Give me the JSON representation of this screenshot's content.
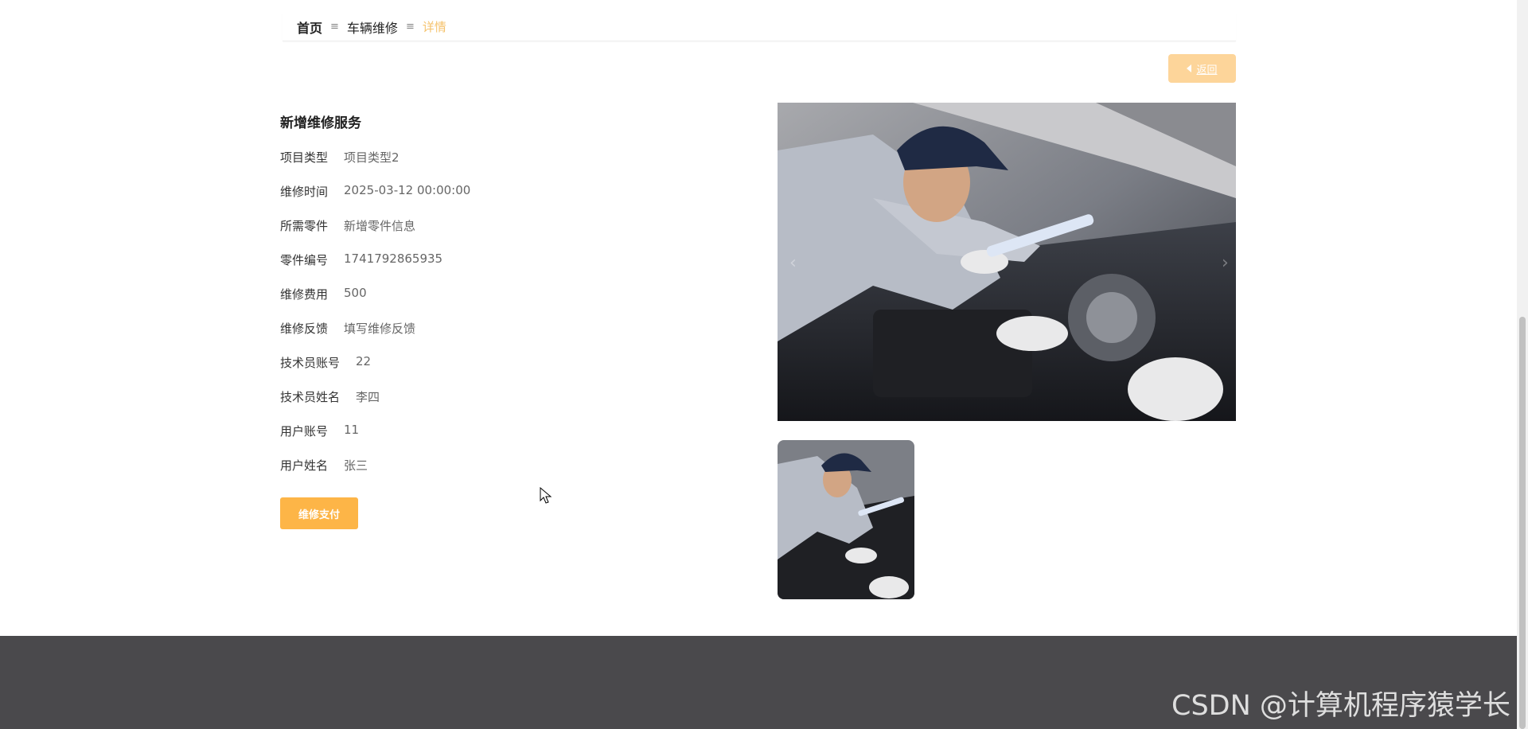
{
  "breadcrumb": {
    "home": "首页",
    "section": "车辆维修",
    "current": "详情",
    "separator": "≡"
  },
  "back_button": {
    "label": "返回",
    "icon": "caret-left-icon"
  },
  "detail": {
    "title": "新增维修服务",
    "fields": [
      {
        "label": "项目类型",
        "value": "项目类型2"
      },
      {
        "label": "维修时间",
        "value": "2025-03-12 00:00:00"
      },
      {
        "label": "所需零件",
        "value": "新增零件信息"
      },
      {
        "label": "零件编号",
        "value": "1741792865935"
      },
      {
        "label": "维修费用",
        "value": "500"
      },
      {
        "label": "维修反馈",
        "value": "填写维修反馈"
      },
      {
        "label": "技术员账号",
        "value": "22"
      },
      {
        "label": "技术员姓名",
        "value": "李四"
      },
      {
        "label": "用户账号",
        "value": "11"
      },
      {
        "label": "用户姓名",
        "value": "张三"
      }
    ],
    "pay_button": "维修支付"
  },
  "carousel": {
    "prev_icon": "chevron-left-icon",
    "next_icon": "chevron-right-icon"
  },
  "watermark": "CSDN @计算机程序猿学长",
  "colors": {
    "accent": "#fdb547",
    "back_button": "#fdd59a",
    "breadcrumb_current": "#f5c26b",
    "footer": "#4a494c"
  }
}
